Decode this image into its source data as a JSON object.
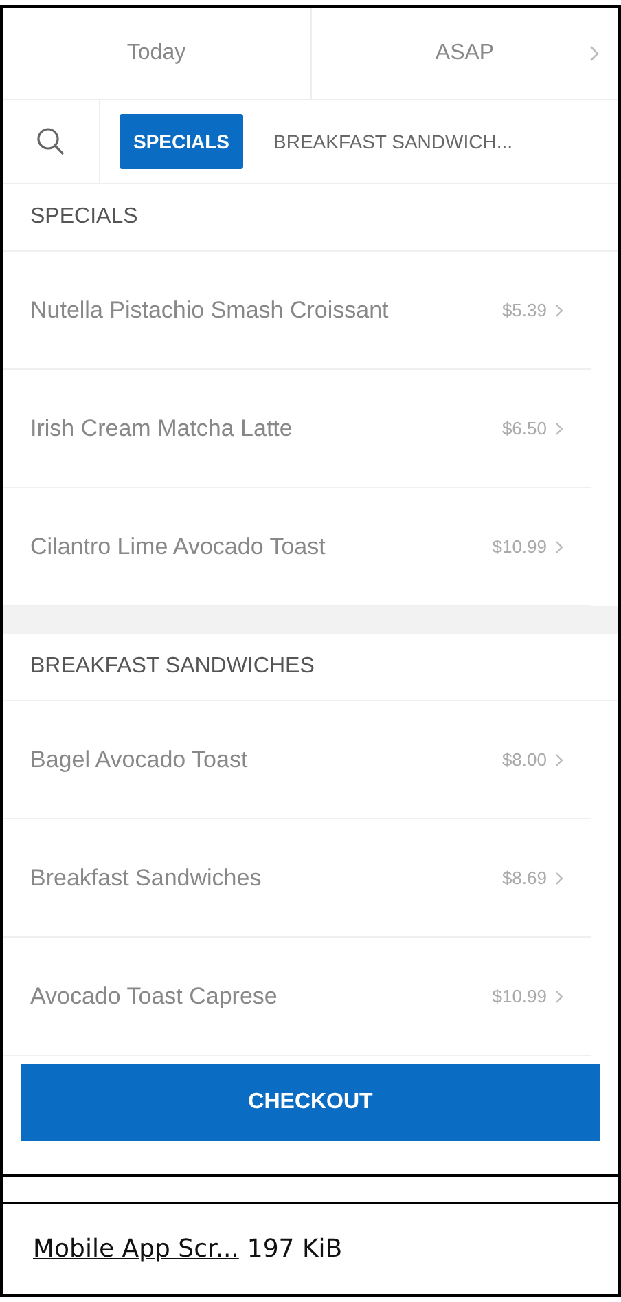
{
  "top_bar": {
    "day": "Today",
    "time": "ASAP"
  },
  "categories": [
    {
      "label": "SPECIALS",
      "selected": true
    },
    {
      "label": "BREAKFAST SANDWICH...",
      "selected": false
    }
  ],
  "sections": [
    {
      "title": "SPECIALS",
      "items": [
        {
          "name": "Nutella Pistachio Smash Croissant",
          "price": "$5.39"
        },
        {
          "name": "Irish Cream Matcha Latte",
          "price": "$6.50"
        },
        {
          "name": "Cilantro Lime Avocado Toast",
          "price": "$10.99"
        }
      ]
    },
    {
      "title": "BREAKFAST SANDWICHES",
      "items": [
        {
          "name": "Bagel Avocado Toast",
          "price": "$8.00"
        },
        {
          "name": "Breakfast Sandwiches",
          "price": "$8.69"
        },
        {
          "name": "Avocado Toast Caprese",
          "price": "$10.99"
        }
      ]
    }
  ],
  "checkout": "CHECKOUT",
  "file": {
    "name": "Mobile App Scr...",
    "size": "197 KiB"
  }
}
